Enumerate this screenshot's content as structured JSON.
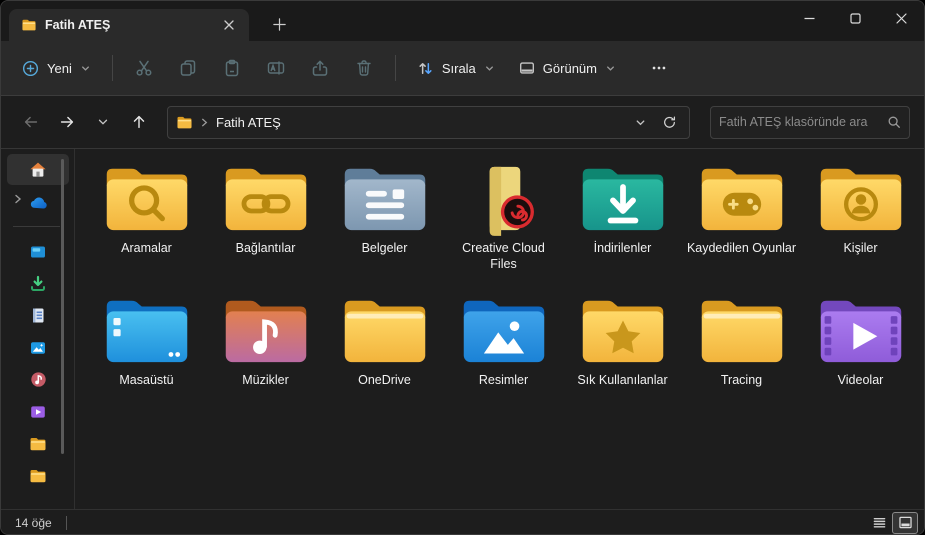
{
  "window": {
    "tab_title": "Fatih ATEŞ",
    "controls": [
      "minimize",
      "maximize",
      "close"
    ]
  },
  "toolbar": {
    "new_label": "Yeni",
    "sort_label": "Sırala",
    "view_label": "Görünüm",
    "buttons": [
      "new",
      "cut",
      "copy",
      "paste",
      "rename",
      "share",
      "delete",
      "sort",
      "view",
      "more"
    ]
  },
  "address": {
    "breadcrumb": "Fatih ATEŞ"
  },
  "search": {
    "placeholder": "Fatih ATEŞ klasöründe ara"
  },
  "sidebar": {
    "items": [
      {
        "name": "home",
        "icon": "home-icon",
        "selected": true
      },
      {
        "name": "onedrive",
        "icon": "onedrive-icon",
        "chevron": true
      },
      {
        "divider": true
      },
      {
        "name": "desktop",
        "icon": "desktop-icon"
      },
      {
        "name": "downloads",
        "icon": "downloads-icon"
      },
      {
        "name": "documents",
        "icon": "documents-icon"
      },
      {
        "name": "pictures",
        "icon": "pictures-icon"
      },
      {
        "name": "music",
        "icon": "music-icon"
      },
      {
        "name": "videos",
        "icon": "videos-icon"
      },
      {
        "name": "folder-1",
        "icon": "folder-icon"
      },
      {
        "name": "folder-2",
        "icon": "folder-icon"
      }
    ]
  },
  "items": [
    {
      "label": "Aramalar",
      "icon": "folder-search"
    },
    {
      "label": "Bağlantılar",
      "icon": "folder-link"
    },
    {
      "label": "Belgeler",
      "icon": "folder-documents"
    },
    {
      "label": "Creative Cloud Files",
      "icon": "folder-creative-cloud"
    },
    {
      "label": "İndirilenler",
      "icon": "folder-downloads"
    },
    {
      "label": "Kaydedilen Oyunlar",
      "icon": "folder-saved-games"
    },
    {
      "label": "Kişiler",
      "icon": "folder-contacts"
    },
    {
      "label": "Masaüstü",
      "icon": "folder-desktop"
    },
    {
      "label": "Müzikler",
      "icon": "folder-music"
    },
    {
      "label": "OneDrive",
      "icon": "folder-plain"
    },
    {
      "label": "Resimler",
      "icon": "folder-pictures"
    },
    {
      "label": "Sık Kullanılanlar",
      "icon": "folder-favorites"
    },
    {
      "label": "Tracing",
      "icon": "folder-plain"
    },
    {
      "label": "Videolar",
      "icon": "folder-videos"
    }
  ],
  "statusbar": {
    "item_count": "14 öğe"
  },
  "colors": {
    "folder_yellow": "#f5bb42",
    "folder_yellow_tab": "#d99a20",
    "folder_glyph_gold": "#b8890f",
    "downloads_teal": "#1f9e8d",
    "desktop_blue": "#2ea3e6",
    "pictures_blue": "#2390dd",
    "videos_purple": "#9a6ade",
    "music_orange_pink": "#d3776f",
    "documents_steel": "#8da6bd",
    "creative_cloud_red": "#d92b2f",
    "accent_blue": "#56a8d8",
    "toolbar_bg": "#2a2a2a",
    "content_bg": "#1d1d1d"
  }
}
